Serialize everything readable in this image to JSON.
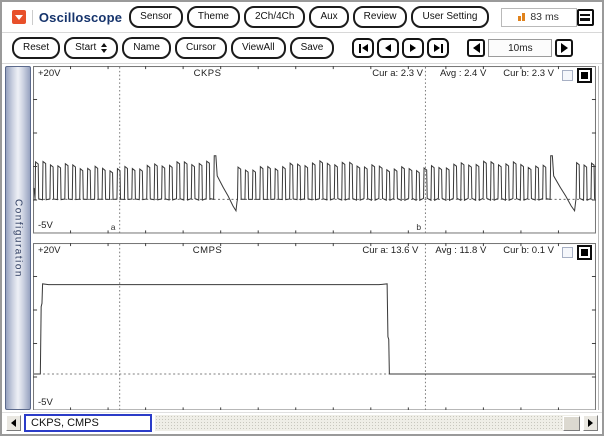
{
  "app": {
    "title": "Oscilloscope",
    "time_display": "83 ms"
  },
  "toolbar1": {
    "buttons": [
      "Sensor",
      "Theme",
      "2Ch/4Ch",
      "Aux",
      "Review",
      "User Setting"
    ]
  },
  "toolbar2": {
    "buttons": [
      "Reset",
      "Start",
      "Name",
      "Cursor",
      "ViewAll",
      "Save"
    ],
    "timebase": "10ms"
  },
  "sidebar": {
    "label": "Configuration"
  },
  "statusbar": {
    "channels_label": "CKPS, CMPS"
  },
  "chart_data": [
    {
      "type": "line",
      "title": "CKPS",
      "y_top_label": "+20V",
      "y_bottom_label": "-5V",
      "ylim": [
        -5,
        20
      ],
      "x_divisions": 15,
      "y_divisions": 5,
      "readouts": {
        "cur_a": "Cur a: 2.3 V",
        "avg": "Avg : 2.4 V",
        "cur_b": "Cur b: 2.3 V"
      },
      "cursors": {
        "a_label": "a",
        "b_label": "b",
        "a_frac": 0.154,
        "b_frac": 0.697
      },
      "waveform": {
        "kind": "toothed",
        "low_v": 0.1,
        "high_v": 5.1,
        "pre_gap_peak_v": 6.6,
        "gap_dip_v": -1.6,
        "zero_ref_v": 0.1,
        "tooth_period_frac": 0.01322,
        "gaps_frac": [
          [
            0.3225,
            0.3623
          ],
          [
            0.9239,
            0.9637
          ]
        ]
      }
    },
    {
      "type": "line",
      "title": "CMPS",
      "y_top_label": "+20V",
      "y_bottom_label": "-5V",
      "ylim": [
        -5,
        20
      ],
      "x_divisions": 15,
      "y_divisions": 5,
      "readouts": {
        "cur_a": "Cur a: 13.6 V",
        "avg": "Avg : 11.8 V",
        "cur_b": "Cur b: 0.1 V"
      },
      "cursors": {
        "a_frac": 0.154,
        "b_frac": 0.697
      },
      "waveform": {
        "kind": "pulse",
        "low_v": 0.45,
        "high_v": 13.9,
        "zero_ref_v": 0.45,
        "rise_frac": 0.013,
        "fall_frac": 0.629
      }
    }
  ]
}
